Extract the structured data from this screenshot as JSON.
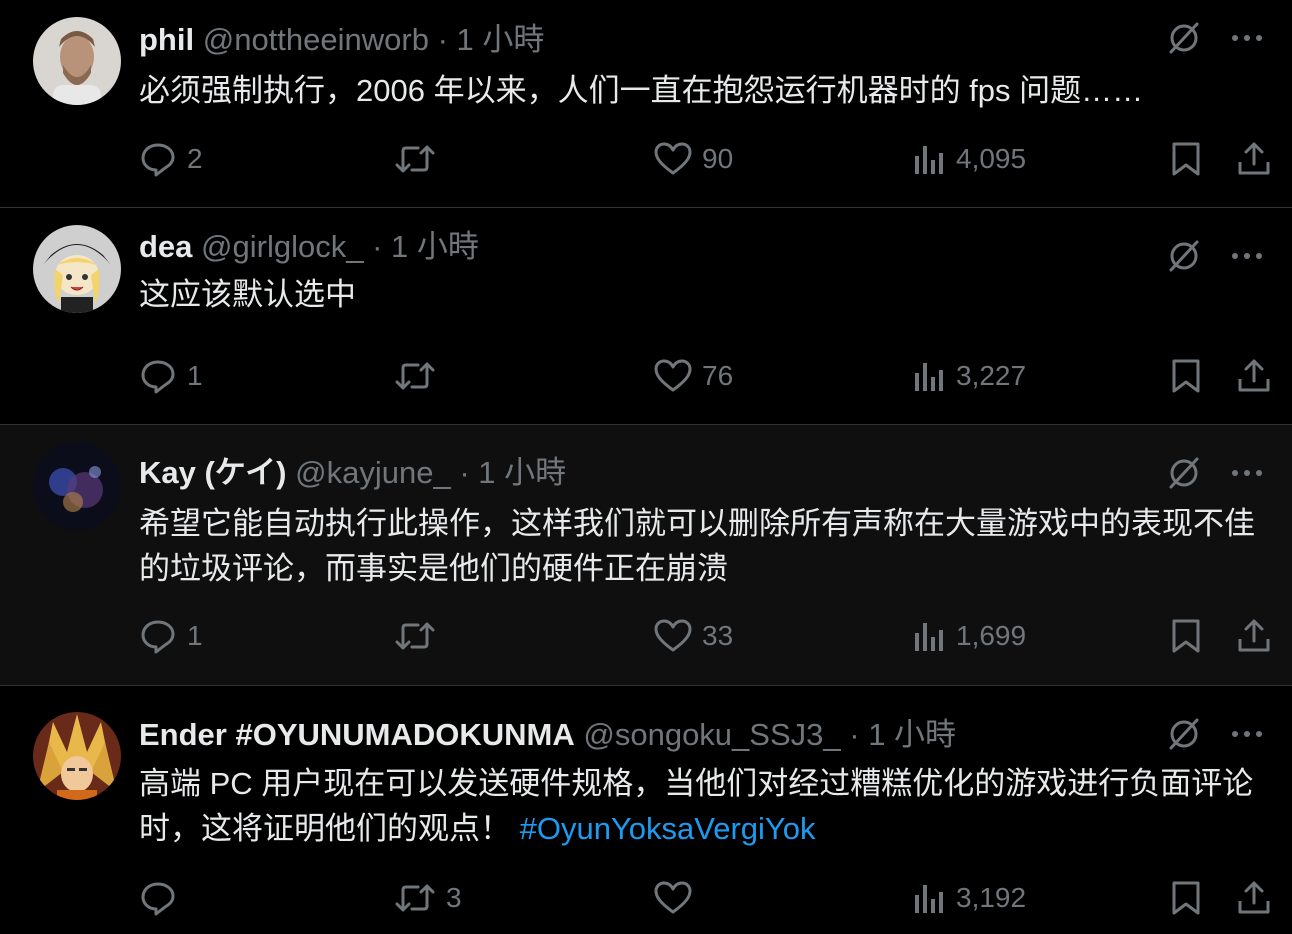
{
  "tweets": [
    {
      "name": "phil",
      "handle": "@nottheeinworb",
      "separator": "·",
      "time": "1 小時",
      "text": "必须强制执行，2006 年以来，人们一直在抱怨运行机器时的 fps 问题……",
      "hashtag": "",
      "replies": "2",
      "retweets": "",
      "likes": "90",
      "views": "4,095",
      "avatar": "man-with-beard-photo"
    },
    {
      "name": "dea",
      "handle": "@girlglock_",
      "separator": "·",
      "time": "1 小時",
      "text": "这应该默认选中",
      "hashtag": "",
      "replies": "1",
      "retweets": "",
      "likes": "76",
      "views": "3,227",
      "avatar": "anime-girl-drawing"
    },
    {
      "name": "Kay (ケイ)",
      "handle": "@kayjune_",
      "separator": "·",
      "time": "1 小時",
      "text": "希望它能自动执行此操作，这样我们就可以删除所有声称在大量游戏中的表现不佳的垃圾评论，而事实是他们的硬件正在崩溃",
      "hashtag": "",
      "replies": "1",
      "retweets": "",
      "likes": "33",
      "views": "1,699",
      "avatar": "dark-concert-photo"
    },
    {
      "name": "Ender #OYUNUMADOKUNMA",
      "handle": "@songoku_SSJ3_",
      "separator": "·",
      "time": "1 小時",
      "text": "高端 PC 用户现在可以发送硬件规格，当他们对经过糟糕优化的游戏进行负面评论时，这将证明他们的观点！",
      "hashtag": "#OyunYoksaVergiYok",
      "replies": "",
      "retweets": "3",
      "likes": "",
      "views": "3,192",
      "avatar": "super-saiyan-3-drawing"
    }
  ],
  "colors": {
    "background": "#000000",
    "text": "#e7e9ea",
    "muted": "#71767b",
    "link": "#1d9bf0",
    "divider": "#2f3336"
  },
  "icons": [
    "mute-icon",
    "more-icon",
    "reply-icon",
    "retweet-icon",
    "like-icon",
    "views-icon",
    "bookmark-icon",
    "share-icon"
  ]
}
